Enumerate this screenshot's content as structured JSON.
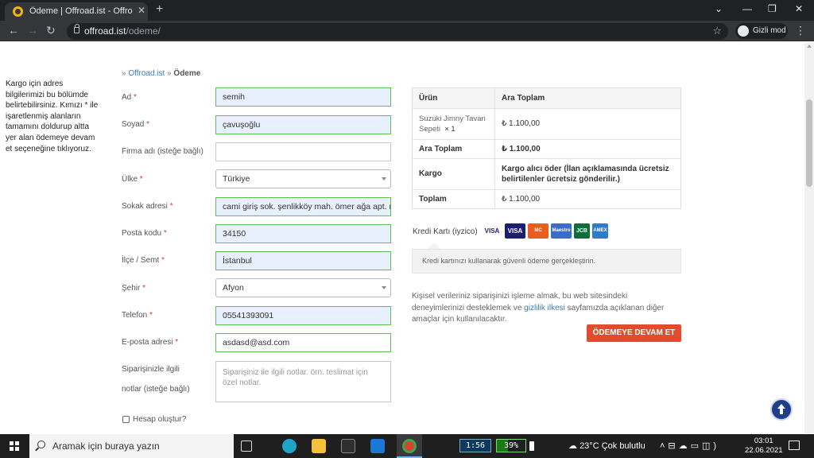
{
  "browser": {
    "tab_title": "Ödeme | Offroad.ist - Offroad.ist",
    "url_host": "offroad.ist",
    "url_path": "/odeme/",
    "incognito_label": "Gizli mod"
  },
  "page": {
    "side_note": "Kargo için adres bilgilerimizi bu bölümde belirtebilirsiniz. Kımızı * ile işaretlenmiş alanların tamamını doldurup altta yer alan ödemeye devam et seçeneğine tıklıyoruz.",
    "breadcrumb": {
      "sep1": "» ",
      "home": "Offroad.ist",
      "sep2": " » ",
      "current": "Ödeme"
    },
    "form": [
      {
        "label": "Ad",
        "required": "*",
        "value": "semih"
      },
      {
        "label": "Soyad",
        "required": "*",
        "value": "çavuşoğlu"
      },
      {
        "label": "Firma adı (isteğe bağlı)",
        "required": "",
        "value": ""
      },
      {
        "label": "Ülke",
        "required": "*",
        "value": "Türkiye"
      },
      {
        "label": "Sokak adresi",
        "required": "*",
        "value": "cami giriş sok. şenlikköy mah. ömer ağa apt. no:"
      },
      {
        "label": "Posta kodu",
        "required": "*",
        "value": "34150"
      },
      {
        "label": "İlçe / Semt",
        "required": "*",
        "value": "İstanbul"
      },
      {
        "label": "Şehir",
        "required": "*",
        "value": "Afyon"
      },
      {
        "label": "Telefon",
        "required": "*",
        "value": "05541393091"
      },
      {
        "label": "E-posta adresi",
        "required": "*",
        "value": "asdasd@asd.com"
      }
    ],
    "notes": {
      "label_line1": "Siparişinizle ilgili",
      "label_line2": "notlar (isteğe bağlı)",
      "placeholder": "Siparişiniz ile ilgili notlar. örn. teslimat için özel notlar."
    },
    "create_account": "Hesap oluştur?",
    "order": {
      "head": [
        "Ürün",
        "Ara Toplam"
      ],
      "product_name": "Suzuki Jimny Tavan Sepeti",
      "product_qty": "× 1",
      "product_price": "₺ 1.100,00",
      "subtotal_label": "Ara Toplam",
      "subtotal_value": "₺ 1.100,00",
      "shipping_label": "Kargo",
      "shipping_value": "Kargo alıcı öder (İlan açıklamasında ücretsiz belirtilenler ücretsiz gönderilir.)",
      "total_label": "Toplam",
      "total_value": "₺ 1.100,00"
    },
    "payment": {
      "method_label": "Kredi Kartı (iyzico)",
      "cards": [
        "VISA",
        "VISA",
        "MC",
        "Maestro",
        "JCB",
        "AMEX"
      ],
      "info": "Kredi kartınızı kullanarak güvenli ödeme gerçekleştirin."
    },
    "privacy": {
      "before": "Kişisel verileriniz siparişinizi işleme almak, bu web sitesindeki deneyimlerinizi desteklemek ve ",
      "link": "gizlilik ilkesi",
      "after": " sayfamızda açıklanan diğer amaçlar için kullanılacaktır."
    },
    "cta": "ÖDEMEYE DEVAM ET"
  },
  "taskbar": {
    "search_placeholder": "Aramak için buraya yazın",
    "cpu": "1:56",
    "battery": "39%",
    "battery_level": 0.39,
    "weather": "23°C  Çok bulutlu",
    "time": "03:01",
    "date": "22.06.2021"
  },
  "colors": {
    "accent": "#e34a2f",
    "link": "#3a7bbf",
    "field_ok": "#5fbf52"
  }
}
